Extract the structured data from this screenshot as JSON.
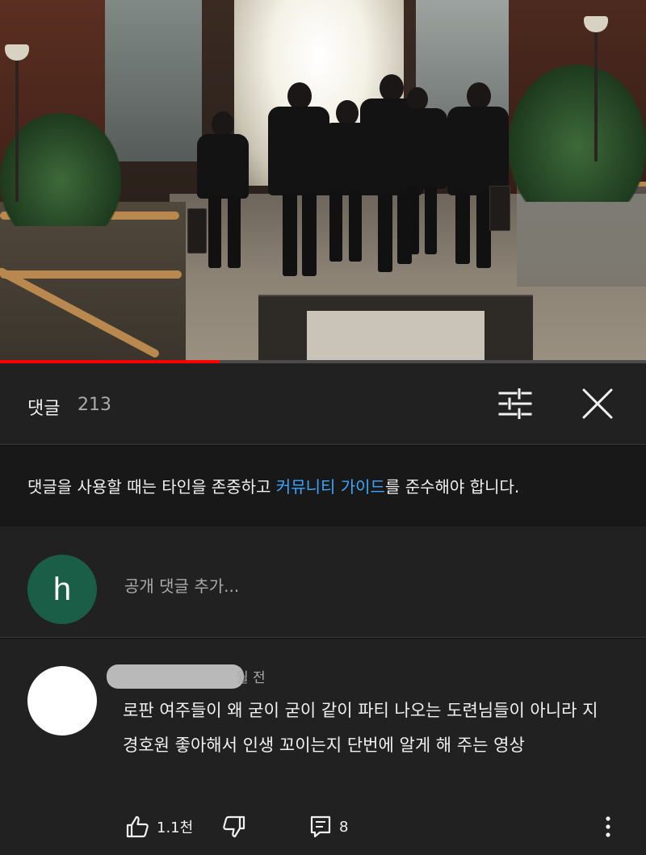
{
  "video": {
    "progress": 0.34
  },
  "comments_header": {
    "title": "댓글",
    "count": "213"
  },
  "guideline": {
    "before": "댓글을 사용할 때는 타인을 존중하고 ",
    "link": "커뮤니티 가이드",
    "after": "를 준수해야 합니다."
  },
  "add_comment": {
    "avatar_letter": "h",
    "avatar_color": "#1b5e48",
    "placeholder": "공개 댓글 추가..."
  },
  "comment": {
    "time": "월 전",
    "text": "로판 여주들이 왜 굳이 굳이 같이 파티 나오는 도련님들이 아니라 지 경호원 좋아해서 인생 꼬이는지 단번에 알게 해 주는 영상",
    "likes": "1.1천",
    "replies": "8"
  },
  "icons": {
    "filter": "sliders-icon",
    "close": "close-icon",
    "like": "thumbs-up-icon",
    "dislike": "thumbs-down-icon",
    "reply": "reply-comment-icon",
    "more": "more-vertical-icon"
  },
  "colors": {
    "accent_link": "#3ea6ff",
    "progress": "#ff0000",
    "panel": "#212121"
  }
}
